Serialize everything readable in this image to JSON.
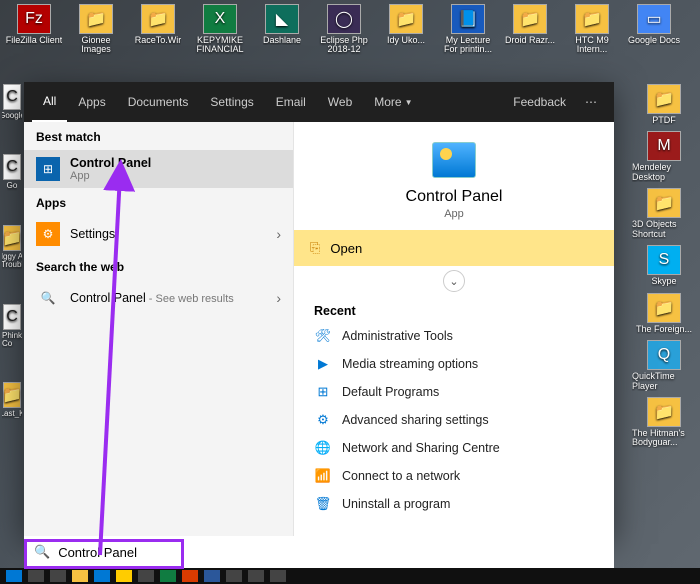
{
  "desktop_icons_row1": [
    {
      "label": "FileZilla Client",
      "glyph": "Fz",
      "bg": "#b30000"
    },
    {
      "label": "Gionee Images",
      "glyph": "📁",
      "bg": "#f6c142"
    },
    {
      "label": "RaceTo.Wir",
      "glyph": "📁",
      "bg": "#f6c142"
    },
    {
      "label": "KEPYMIKE FINANCIAL",
      "glyph": "X",
      "bg": "#107c41"
    },
    {
      "label": "Dashlane",
      "glyph": "◣",
      "bg": "#0e6e5c"
    },
    {
      "label": "Eclipse Php 2018-12",
      "glyph": "◯",
      "bg": "#3a2c55"
    },
    {
      "label": "Idy Uko...",
      "glyph": "📁",
      "bg": "#f6c142"
    },
    {
      "label": "My Lecture For printin...",
      "glyph": "📘",
      "bg": "#185abd"
    },
    {
      "label": "Droid Razr...",
      "glyph": "📁",
      "bg": "#f6c142"
    },
    {
      "label": "HTC M9 Intern...",
      "glyph": "📁",
      "bg": "#f6c142"
    },
    {
      "label": "Google Docs",
      "glyph": "▭",
      "bg": "#4285f4"
    }
  ],
  "desktop_icons_right_extra": [
    {
      "label": "PTDF",
      "glyph": "📁",
      "bg": "#f6c142"
    },
    {
      "label": "Mendeley Desktop",
      "glyph": "M",
      "bg": "#9b1b1b"
    },
    {
      "label": "3D Objects Shortcut",
      "glyph": "📁",
      "bg": "#f6c142"
    },
    {
      "label": "Skype",
      "glyph": "S",
      "bg": "#00aff0"
    },
    {
      "label": "The Foreign...",
      "glyph": "📁",
      "bg": "#f6c142"
    },
    {
      "label": "QuickTime Player",
      "glyph": "Q",
      "bg": "#29a0d8"
    },
    {
      "label": "The Hitman's Bodyguar...",
      "glyph": "📁",
      "bg": "#f6c142"
    }
  ],
  "desktop_icons_left_extra": [
    {
      "label": "Google",
      "glyph": "C",
      "bg": "#ffffff"
    },
    {
      "label": "Go",
      "glyph": "C",
      "bg": "#ffffff"
    },
    {
      "label": "Iggy A Troubl",
      "glyph": "📁",
      "bg": "#f6c142"
    },
    {
      "label": "Phink Co",
      "glyph": "C",
      "bg": "#ffffff"
    },
    {
      "label": "Last_K",
      "glyph": "📁",
      "bg": "#f6c142"
    }
  ],
  "tabs": {
    "all": "All",
    "apps": "Apps",
    "documents": "Documents",
    "settings": "Settings",
    "email": "Email",
    "web": "Web",
    "more": "More",
    "feedback": "Feedback"
  },
  "left": {
    "best_match": "Best match",
    "result_title": "Control Panel",
    "result_sub": "App",
    "apps_header": "Apps",
    "apps_item": "Settings",
    "search_web_header": "Search the web",
    "web_item": "Control Panel",
    "web_item_sub": " - See web results"
  },
  "right": {
    "title": "Control Panel",
    "sub": "App",
    "open": "Open",
    "recent": "Recent",
    "items": [
      "Administrative Tools",
      "Media streaming options",
      "Default Programs",
      "Advanced sharing settings",
      "Network and Sharing Centre",
      "Connect to a network",
      "Uninstall a program"
    ]
  },
  "search": {
    "value": "Control Panel"
  }
}
